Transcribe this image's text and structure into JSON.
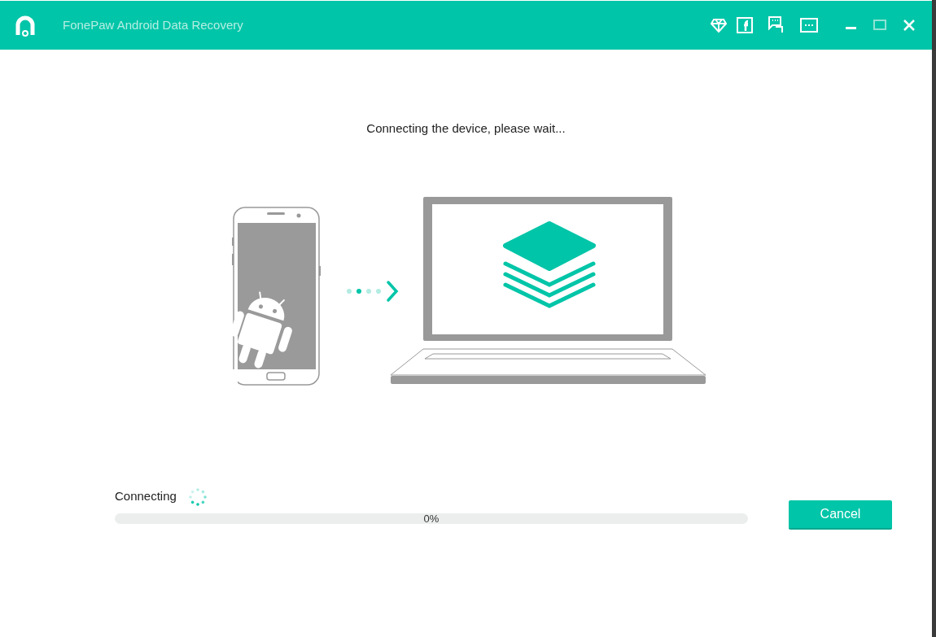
{
  "window": {
    "title": "FonePaw Android Data Recovery"
  },
  "message": "Connecting the device, please wait...",
  "status": {
    "label": "Connecting"
  },
  "progress": {
    "level": 0,
    "reading": "0%"
  },
  "buttons": [
    {
      "label": "Cancel"
    }
  ]
}
